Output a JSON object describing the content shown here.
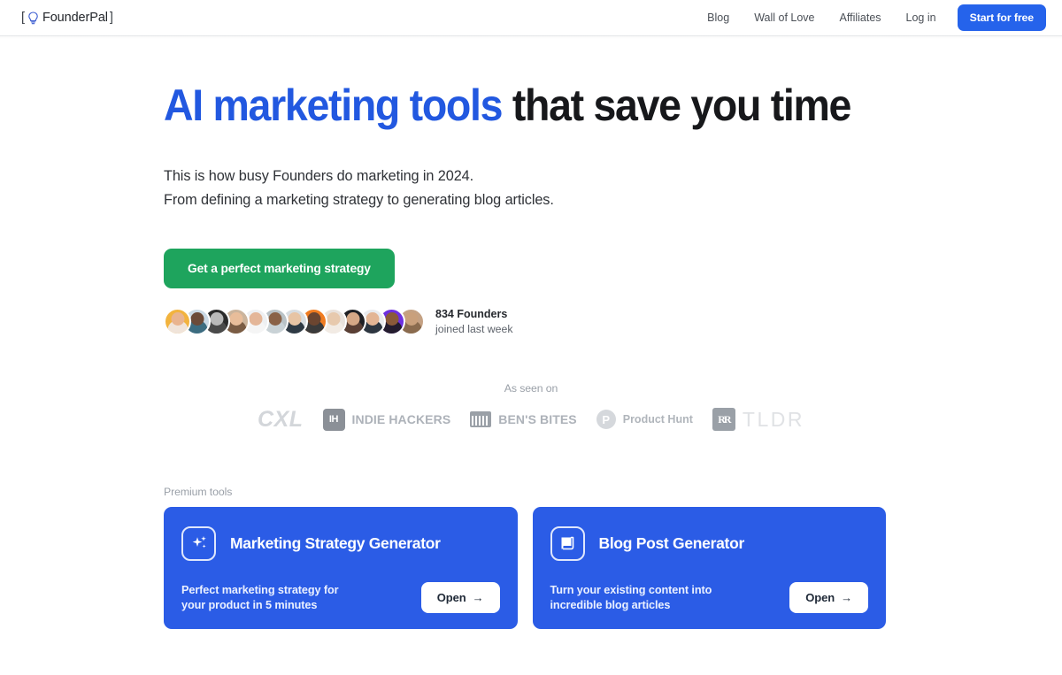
{
  "header": {
    "logo": {
      "left_bracket": "[",
      "icon": "lightbulb-icon",
      "name": "FounderPal",
      "right_bracket": "]"
    },
    "nav": [
      {
        "label": "Blog",
        "name": "nav-link-blog"
      },
      {
        "label": "Wall of Love",
        "name": "nav-link-wall-of-love"
      },
      {
        "label": "Affiliates",
        "name": "nav-link-affiliates"
      },
      {
        "label": "Log in",
        "name": "nav-link-log-in"
      }
    ],
    "cta": "Start for free"
  },
  "hero": {
    "headline_highlight": "AI marketing tools",
    "headline_rest": " that save you time",
    "subtitle_line1": "This is how busy Founders do marketing in 2024.",
    "subtitle_line2": "From defining a marketing strategy to generating blog articles.",
    "cta": "Get a perfect marketing strategy",
    "social_proof": {
      "count": "834 Founders",
      "caption": "joined last week",
      "avatars": [
        {
          "bg": "#f2b33e",
          "face": "#e9b48f",
          "body": "#f0e4da"
        },
        {
          "bg": "#c9d8e4",
          "face": "#6b4a38",
          "body": "#3c6c80"
        },
        {
          "bg": "#2b2b2b",
          "face": "#b9b9b9",
          "body": "#4a4a4a"
        },
        {
          "bg": "#cbb49c",
          "face": "#e8bd9a",
          "body": "#7a5c44"
        },
        {
          "bg": "#eef0f2",
          "face": "#e4b698",
          "body": "#f5f5f5"
        },
        {
          "bg": "#b9c2c6",
          "face": "#8a6247",
          "body": "#c9d2d6"
        },
        {
          "bg": "#d8dde1",
          "face": "#e7c4a4",
          "body": "#2f3a44"
        },
        {
          "bg": "#f07c21",
          "face": "#6b4530",
          "body": "#3a3a3a"
        },
        {
          "bg": "#e9e2dc",
          "face": "#e7c9ad",
          "body": "#f2ebe4"
        },
        {
          "bg": "#1f2024",
          "face": "#d6a886",
          "body": "#5a3f34"
        },
        {
          "bg": "#e9ebee",
          "face": "#e3b594",
          "body": "#2d3640"
        },
        {
          "bg": "#6d2fe0",
          "face": "#8a5a3a",
          "body": "#241c2e"
        },
        {
          "bg": "#c4a183",
          "face": "#c9a07c",
          "body": "#8a6b4e"
        }
      ]
    }
  },
  "as_seen_on": {
    "label": "As seen on",
    "logos": [
      {
        "type": "wordmark",
        "text": "CXL",
        "name": "logo-cxl"
      },
      {
        "type": "badge-word",
        "badge": "IH",
        "text": "INDIE HACKERS",
        "name": "logo-indie-hackers"
      },
      {
        "type": "icon-word",
        "text": "BEN'S BITES",
        "name": "logo-bens-bites"
      },
      {
        "type": "circle-word",
        "badge": "P",
        "text": "Product Hunt",
        "name": "logo-product-hunt"
      },
      {
        "type": "rr-tldr",
        "badge": "RR",
        "text": "TLDR",
        "name": "logo-tldr"
      }
    ]
  },
  "premium": {
    "label": "Premium tools",
    "cards": [
      {
        "title": "Marketing Strategy Generator",
        "desc_line1": "Perfect marketing strategy for",
        "desc_line2": "your product in 5 minutes",
        "button": "Open",
        "arrow": "→",
        "icon": "sparkles-icon",
        "name": "card-marketing-strategy-generator"
      },
      {
        "title": "Blog Post Generator",
        "desc_line1": "Turn your existing content into",
        "desc_line2": "incredible blog articles",
        "button": "Open",
        "arrow": "→",
        "icon": "document-scroll-icon",
        "name": "card-blog-post-generator"
      }
    ]
  },
  "colors": {
    "brand_blue": "#2563eb",
    "card_blue": "#2b5ce6",
    "green": "#1ea45d",
    "headline_blue": "#2258e0",
    "text_dark": "#17181b",
    "muted": "#9aa0a8"
  }
}
